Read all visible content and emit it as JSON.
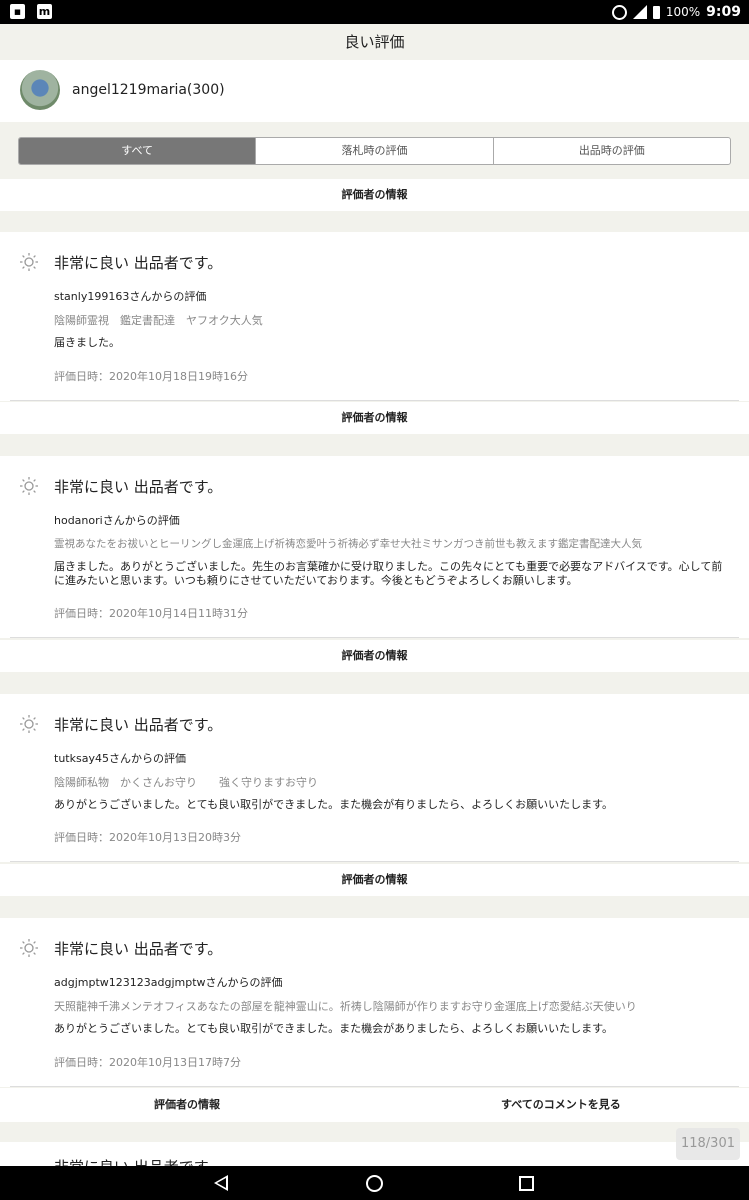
{
  "status_bar": {
    "battery_pct": "100%",
    "time": "9:09",
    "left_icons": [
      "image-icon",
      "m-app-icon"
    ],
    "right_icons": [
      "alarm-icon",
      "signal-icon",
      "battery-icon"
    ]
  },
  "header": {
    "title": "良い評価"
  },
  "user": {
    "name": "angel1219maria(300)"
  },
  "tabs": [
    {
      "label": "すべて",
      "active": true
    },
    {
      "label": "落札時の評価",
      "active": false
    },
    {
      "label": "出品時の評価",
      "active": false
    }
  ],
  "rater_info_label": "評価者の情報",
  "reviews": [
    {
      "headline": "非常に良い 出品者です。",
      "from": "stanly199163さんからの評価",
      "item": "陰陽師霊視　鑑定書配達　ヤフオク大人気",
      "comment": "届きました。",
      "date": "評価日時：2020年10月18日19時16分"
    },
    {
      "headline": "非常に良い 出品者です。",
      "from": "hodanoriさんからの評価",
      "item": "霊視あなたをお祓いとヒーリングし金運底上げ祈祷恋愛叶う祈祷必ず幸せ大社ミサンガつき前世も教えます鑑定書配達大人気",
      "comment": "届きました。ありがとうございました。先生のお言葉確かに受け取りました。この先々にとても重要で必要なアドバイスです。心して前に進みたいと思います。いつも頼りにさせていただいております。今後ともどうぞよろしくお願いします。",
      "date": "評価日時：2020年10月14日11時31分"
    },
    {
      "headline": "非常に良い 出品者です。",
      "from": "tutksay45さんからの評価",
      "item": "陰陽師私物　かくさんお守り　　強く守りますお守り",
      "comment": "ありがとうございました。とても良い取引ができました。また機会が有りましたら、よろしくお願いいたします。",
      "date": "評価日時：2020年10月13日20時3分"
    },
    {
      "headline": "非常に良い 出品者です。",
      "from": "adgjmptw123123adgjmptwさんからの評価",
      "item": "天照龍神千沸メンテオフィスあなたの部屋を龍神霊山に。祈祷し陰陽師が作りますお守り金運底上げ恋愛結ぶ天使いり",
      "comment": "ありがとうございました。とても良い取引ができました。また機会がありましたら、よろしくお願いいたします。",
      "date": "評価日時：2020年10月13日17時7分"
    }
  ],
  "see_all_comments": "すべてのコメントを見る",
  "partial_headline": "非常に良い 出品者です。",
  "page_counter": "118/301"
}
